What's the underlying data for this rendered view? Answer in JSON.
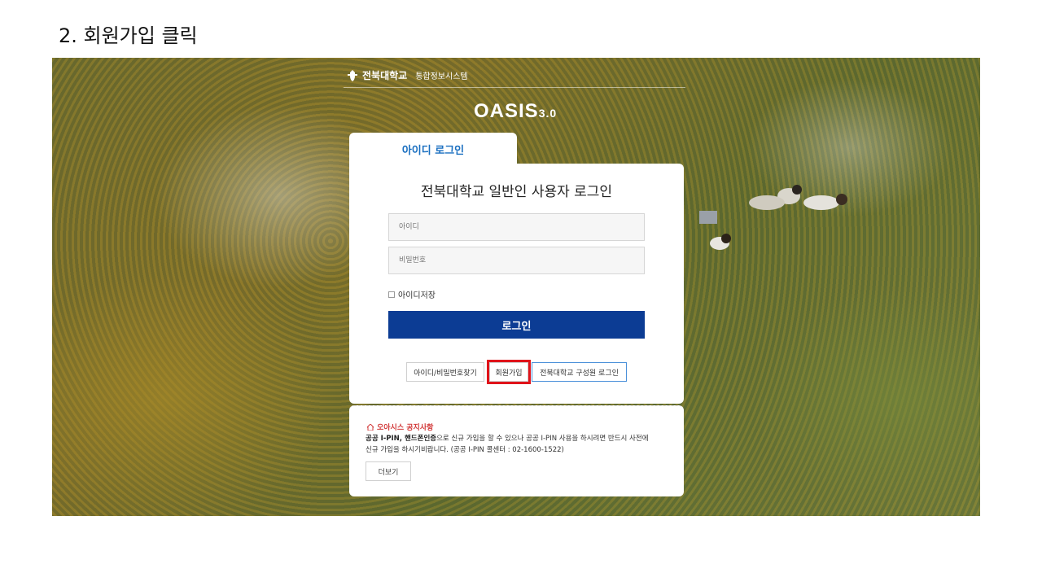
{
  "step": {
    "title": "2. 회원가입 클릭"
  },
  "header": {
    "university": "전북대학교",
    "system": "통합정보시스템",
    "logo_text": "OASIS",
    "logo_version": "3.0"
  },
  "login": {
    "tab_label": "아이디 로그인",
    "title": "전북대학교 일반인 사용자 로그인",
    "id_placeholder": "아이디",
    "pw_placeholder": "비밀번호",
    "remember_label": "아이디저장",
    "login_button": "로그인",
    "find_button": "아이디/비밀번호찾기",
    "signup_button": "회원가입",
    "member_login_button": "전북대학교 구성원 로그인"
  },
  "notice": {
    "heading": "오아시스 공지사항",
    "bold_text": "공공 I-PIN, 핸드폰인증",
    "text_1": "으로 신규 가입을 할 수 있으나 공공 I-PIN 사용을 하시려면 반드시 사전에",
    "text_2": "신규 가입을 하시기비랍니다. (공공 I-PIN 콜센터 : 02-1600-1522)",
    "more_button": "더보기"
  },
  "colors": {
    "primary_button": "#0c3c94",
    "tab_text": "#1a6fc0",
    "highlight": "#e0131a",
    "notice_heading": "#d23a3a"
  }
}
